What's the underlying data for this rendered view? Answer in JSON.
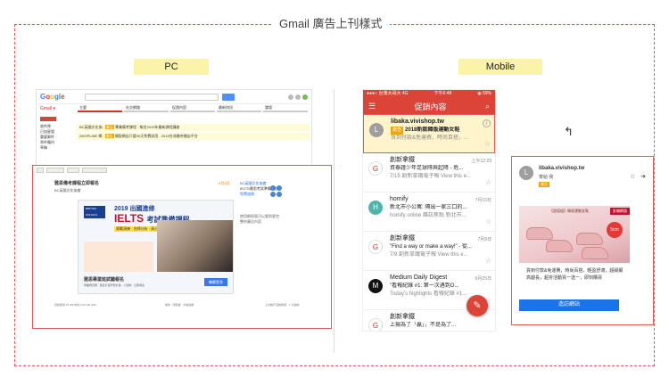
{
  "title": "Gmail 廣告上刊樣式",
  "labels": {
    "pc": "PC",
    "mobile": "Mobile"
  },
  "pc": {
    "logo": "Google",
    "gmail_label": "Gmail ▾",
    "tabs": [
      "主要",
      "社交網路",
      "促銷內容",
      "最新快訊",
      "論壇"
    ],
    "sidebar": [
      "收件匣",
      "已加星號",
      "重要郵件",
      "寄件備份",
      "草稿"
    ],
    "rows": [
      {
        "sender": "BC英國文化協..",
        "tag": "廣告",
        "text": "專業備考課程 - 報名2019年最新課程講座"
      },
      {
        "sender": "SHOPLINE 網..",
        "tag": "廣告",
        "text": "開設網店只要30天免費試用 - 2019台灣最夯開店平台"
      }
    ],
    "email": {
      "subject": "雅思備考課程立即報名",
      "from": "BC英國文化協會",
      "date": "5月3日",
      "side_title": "BC英國文化協會",
      "side_body": "IELTS雅思考試準備課程",
      "side_link": "免費諮詢",
      "side_note": "使用網頁版可以看到更完整的廣告內容",
      "banner": {
        "brand": "BRITISH COUNCIL",
        "year": "2019 出國進修",
        "ielts": "IELTS",
        "ielts_tail": "考試準備課程",
        "sub": "實戰演練 · 名師分析 · 高分攻略",
        "caption": "雅思專業班試聽報名",
        "caption_sub": "專業師資群 · 量身打造學習計畫 · 小班制 · 立即報名",
        "button": "瞭解更多"
      },
      "footer_left": "目前使用 15 GB 中的 0.06 GB (0%)",
      "footer_mid": "條款 · 隱私權 · 計畫政策",
      "footer_right": "上次帳戶活動時間：1 分鐘前"
    }
  },
  "mobile": {
    "status_left": "●●●○ 台灣大哥大 4G",
    "status_mid": "下午6:48",
    "status_right": "◉ 59%",
    "appbar_title": "促銷內容",
    "rows": [
      {
        "avatar": "L",
        "avatar_color": "#9e9e9e",
        "sender": "libaka.vivishop.tw",
        "tag": "廣告",
        "subject": "2018新款韓版運動女鞋",
        "snippet": "貨到付款&免運費，時尚百搭，...",
        "time": ""
      },
      {
        "avatar": "G",
        "avatar_color": "#ffffff",
        "sender": "創新拿鐵",
        "subject": "資泰證少年足球隊與起降 - 危...",
        "snippet": "7/15 創新拿鐵電子報 View this e...",
        "time": "上午12:29"
      },
      {
        "avatar": "H",
        "avatar_color": "#4db6ac",
        "sender": "homify",
        "subject": "新北市小公寓: 隔出一家三口的...",
        "snippet": "homify online 雜誌焦點 新北市...",
        "time": "7月10日"
      },
      {
        "avatar": "G",
        "avatar_color": "#ffffff",
        "sender": "創新拿鐵",
        "subject": "\"Find a way or make a way!\" - 從...",
        "snippet": "7/9 創新拿鐵電子報 View this e...",
        "time": "7月9日"
      },
      {
        "avatar": "M",
        "avatar_color": "#111111",
        "sender": "Medium Daily Digest",
        "subject": "\"看報紀錄 #1: 第一次遇到O...",
        "snippet": "Today's highlights 看報紀錄 #1...",
        "time": "6月25日"
      },
      {
        "avatar": "G",
        "avatar_color": "#ffffff",
        "sender": "創新拿鐵",
        "subject": "上揚為了「贏」，不是為了...",
        "snippet": "",
        "time": ""
      }
    ],
    "fab": "✎",
    "card": {
      "avatar": "L",
      "sender": "libaka.vivishop.tw",
      "to": "寄給 我",
      "tag": "廣告",
      "ribbon": "針織網面",
      "img_title": "【超值組】韓版運動女鞋",
      "badge": "5cm",
      "desc": "貨到付款&免運費，時尚百搭，輕盈舒適，超級顯高腿長，超夯活動買一送一，即刻購買",
      "button": "造訪網站"
    }
  }
}
